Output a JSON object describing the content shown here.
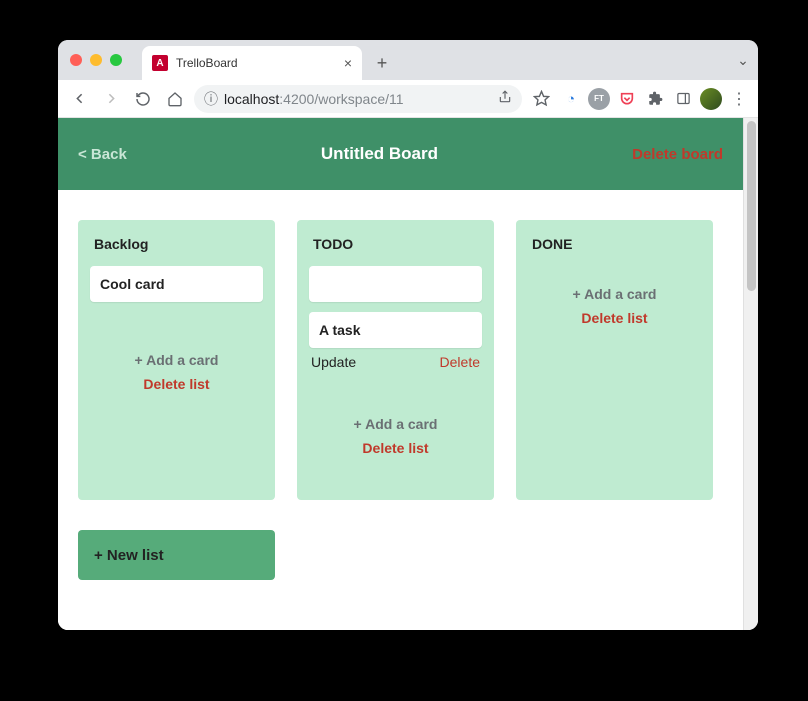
{
  "browser": {
    "tab_title": "TrelloBoard",
    "url_host": "localhost",
    "url_port": ":4200",
    "url_path": "/workspace/11"
  },
  "header": {
    "back_label": "< Back",
    "title": "Untitled Board",
    "delete_label": "Delete board"
  },
  "lists": [
    {
      "title": "Backlog",
      "cards": [
        {
          "text": "Cool card",
          "editing": false
        }
      ],
      "add_card_label": "+ Add a card",
      "delete_list_label": "Delete list"
    },
    {
      "title": "TODO",
      "cards": [
        {
          "text": "",
          "editing": false,
          "is_input": true
        },
        {
          "text": "A task",
          "editing": true,
          "update_label": "Update",
          "delete_label": "Delete"
        }
      ],
      "add_card_label": "+ Add a card",
      "delete_list_label": "Delete list"
    },
    {
      "title": "DONE",
      "cards": [],
      "add_card_label": "+ Add a card",
      "delete_list_label": "Delete list"
    }
  ],
  "new_list_label": "+ New list"
}
